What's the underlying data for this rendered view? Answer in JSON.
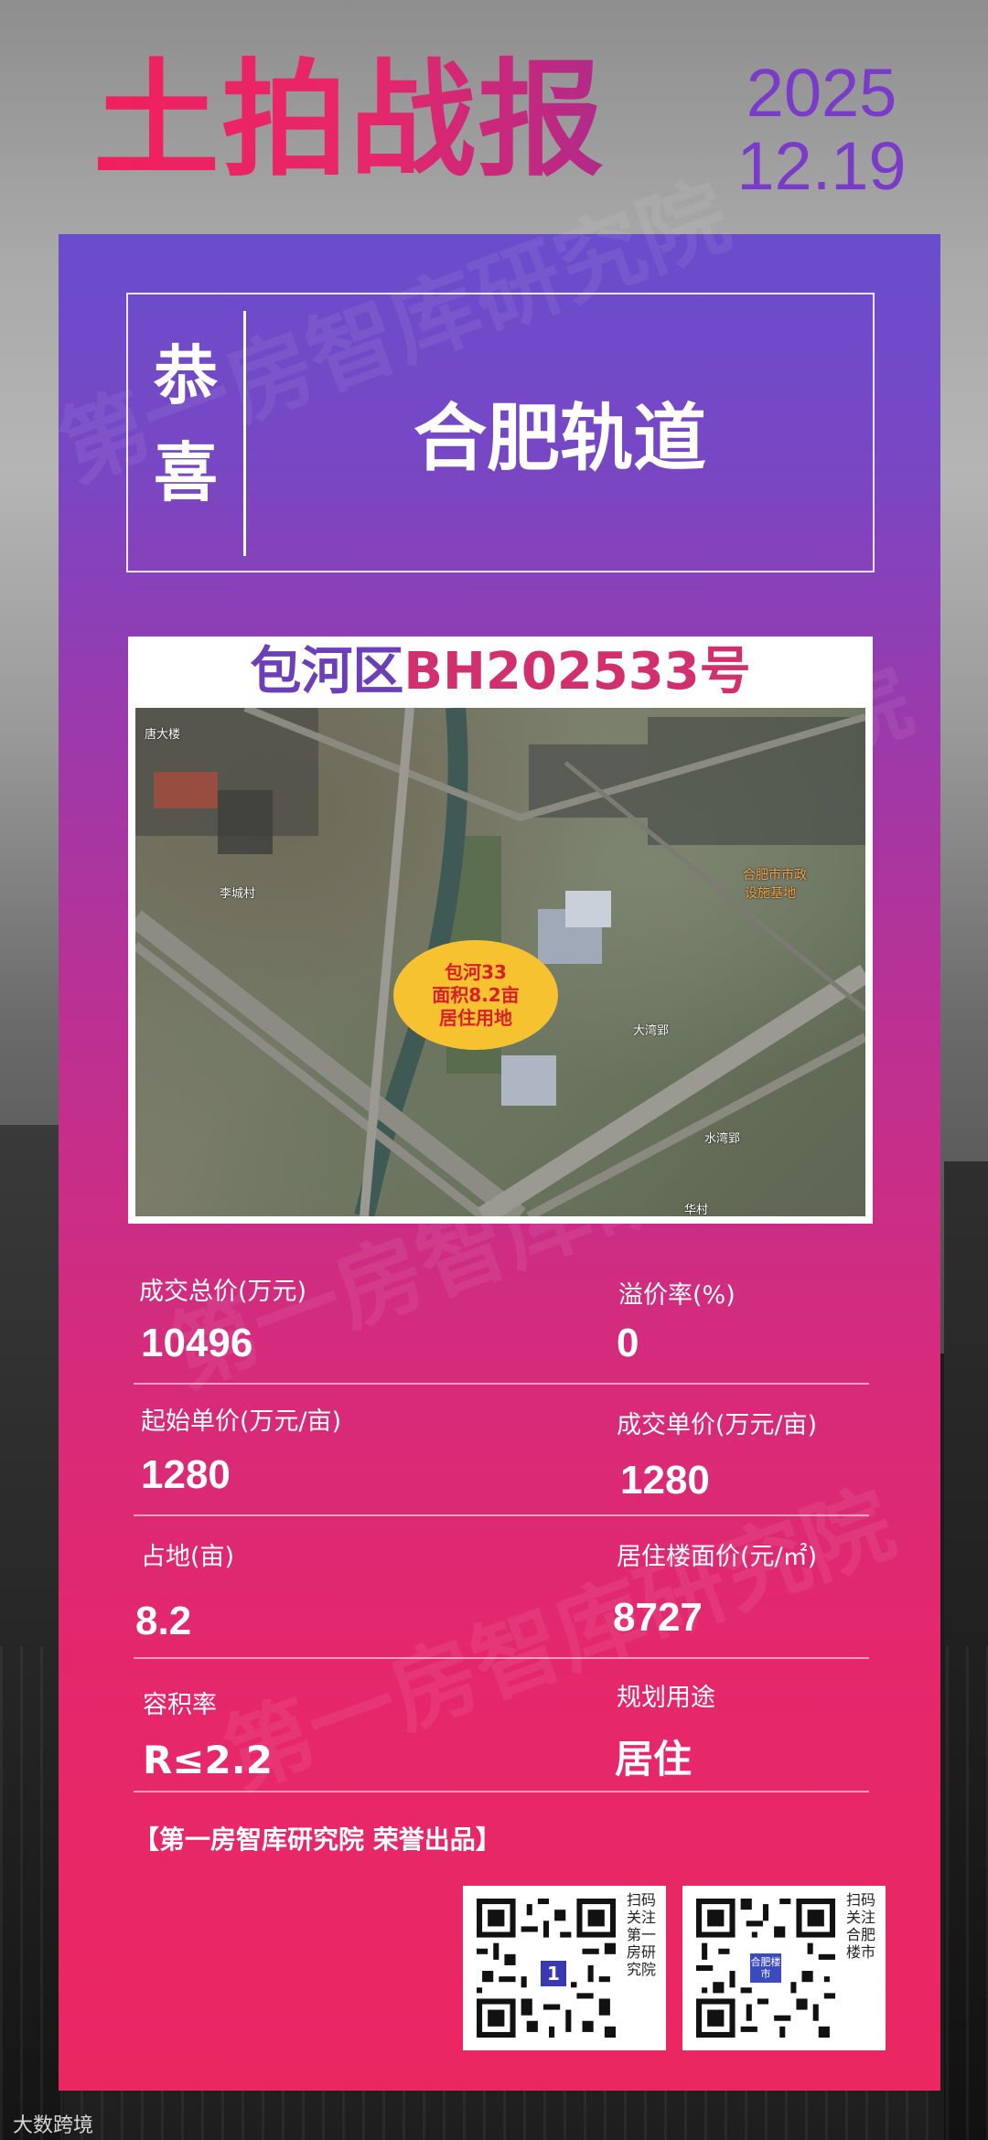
{
  "header": {
    "title": "土拍战报",
    "date_year": "2025",
    "date_day": "12.19"
  },
  "congrats": {
    "label": "恭喜",
    "company": "合肥轨道"
  },
  "parcel": {
    "district": "包河区",
    "code": "BH202533号"
  },
  "map": {
    "oval_line1": "包河33",
    "oval_line2": "面积8.2亩",
    "oval_line3": "居住用地",
    "place_labels": [
      "唐大楼",
      "李城村",
      "合肥市市政",
      "设施基地",
      "大湾郢",
      "水湾郢",
      "华村"
    ]
  },
  "stats": [
    {
      "label": "成交总价(万元)",
      "value": "10496"
    },
    {
      "label": "溢价率(%)",
      "value": "0"
    },
    {
      "label": "起始单价(万元/亩)",
      "value": "1280"
    },
    {
      "label": "成交单价(万元/亩)",
      "value": "1280"
    },
    {
      "label": "占地(亩)",
      "value": "8.2"
    },
    {
      "label": "居住楼面价(元/㎡)",
      "value": "8727"
    },
    {
      "label": "容积率",
      "value": "R≤2.2"
    },
    {
      "label": "规划用途",
      "value": "居住"
    }
  ],
  "credit": "【第一房智库研究院 荣誉出品】",
  "qr": [
    {
      "caption": "扫码关注第一房研究院",
      "badge": "1"
    },
    {
      "caption": "扫码关注合肥楼市",
      "badge": "合肥楼市"
    }
  ],
  "watermark_text": "第一房智库研究院",
  "corner_logo": "大数跨境",
  "colors": {
    "accent_pink": "#e6276a",
    "accent_purple": "#6a4dcc",
    "oval_yellow": "#f6c230"
  }
}
